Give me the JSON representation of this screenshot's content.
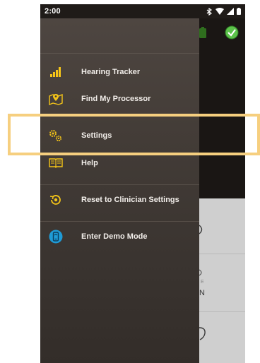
{
  "status_bar": {
    "time": "2:00",
    "icons": [
      "bluetooth-icon",
      "wifi-icon",
      "signal-icon",
      "battery-icon"
    ]
  },
  "drawer": {
    "items": [
      {
        "label": "Hearing Tracker",
        "icon": "signal-bars-icon"
      },
      {
        "label": "Find My Processor",
        "icon": "map-pin-icon"
      },
      {
        "label": "Settings",
        "icon": "gears-icon"
      },
      {
        "label": "Help",
        "icon": "book-icon"
      },
      {
        "label": "Reset to Clinician Settings",
        "icon": "reset-icon"
      },
      {
        "label": "Enter Demo Mode",
        "icon": "demo-icon"
      }
    ]
  },
  "background": {
    "partial_text_1": "E",
    "partial_text_2": "N"
  },
  "colors": {
    "accent": "#f5c518",
    "highlight": "#f6cf7f",
    "drawer_bg": "#433c37",
    "check_green": "#5cc24a",
    "demo_blue": "#1f9bd6"
  }
}
